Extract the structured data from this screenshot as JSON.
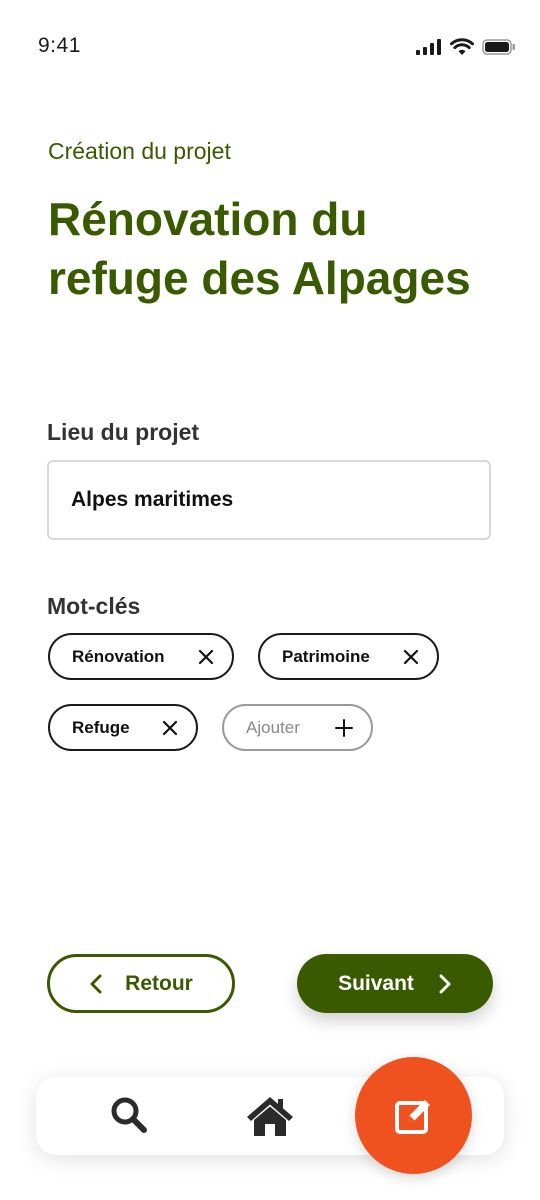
{
  "status_bar": {
    "time": "9:41",
    "icons": [
      "cellular-signal-icon",
      "wifi-icon",
      "battery-icon"
    ]
  },
  "header": {
    "subtitle": "Création du projet",
    "title": "Rénovation du refuge des Alpages"
  },
  "location": {
    "label": "Lieu du projet",
    "value": "Alpes maritimes"
  },
  "keywords": {
    "label": "Mot-clés",
    "chips": [
      {
        "label": "Rénovation",
        "icon": "close-icon"
      },
      {
        "label": "Patrimoine",
        "icon": "close-icon"
      },
      {
        "label": "Refuge",
        "icon": "close-icon"
      }
    ],
    "add_chip": {
      "label": "Ajouter",
      "icon": "plus-icon"
    }
  },
  "actions": {
    "back_label": "Retour",
    "back_icon": "chevron-left-icon",
    "next_label": "Suivant",
    "next_icon": "chevron-right-icon"
  },
  "bottom_nav": {
    "items": [
      "search-icon",
      "home-icon"
    ],
    "fab_icon": "edit-icon"
  },
  "colors": {
    "primary": "#3a5a00",
    "accent": "#f0521f",
    "text": "#333333"
  }
}
